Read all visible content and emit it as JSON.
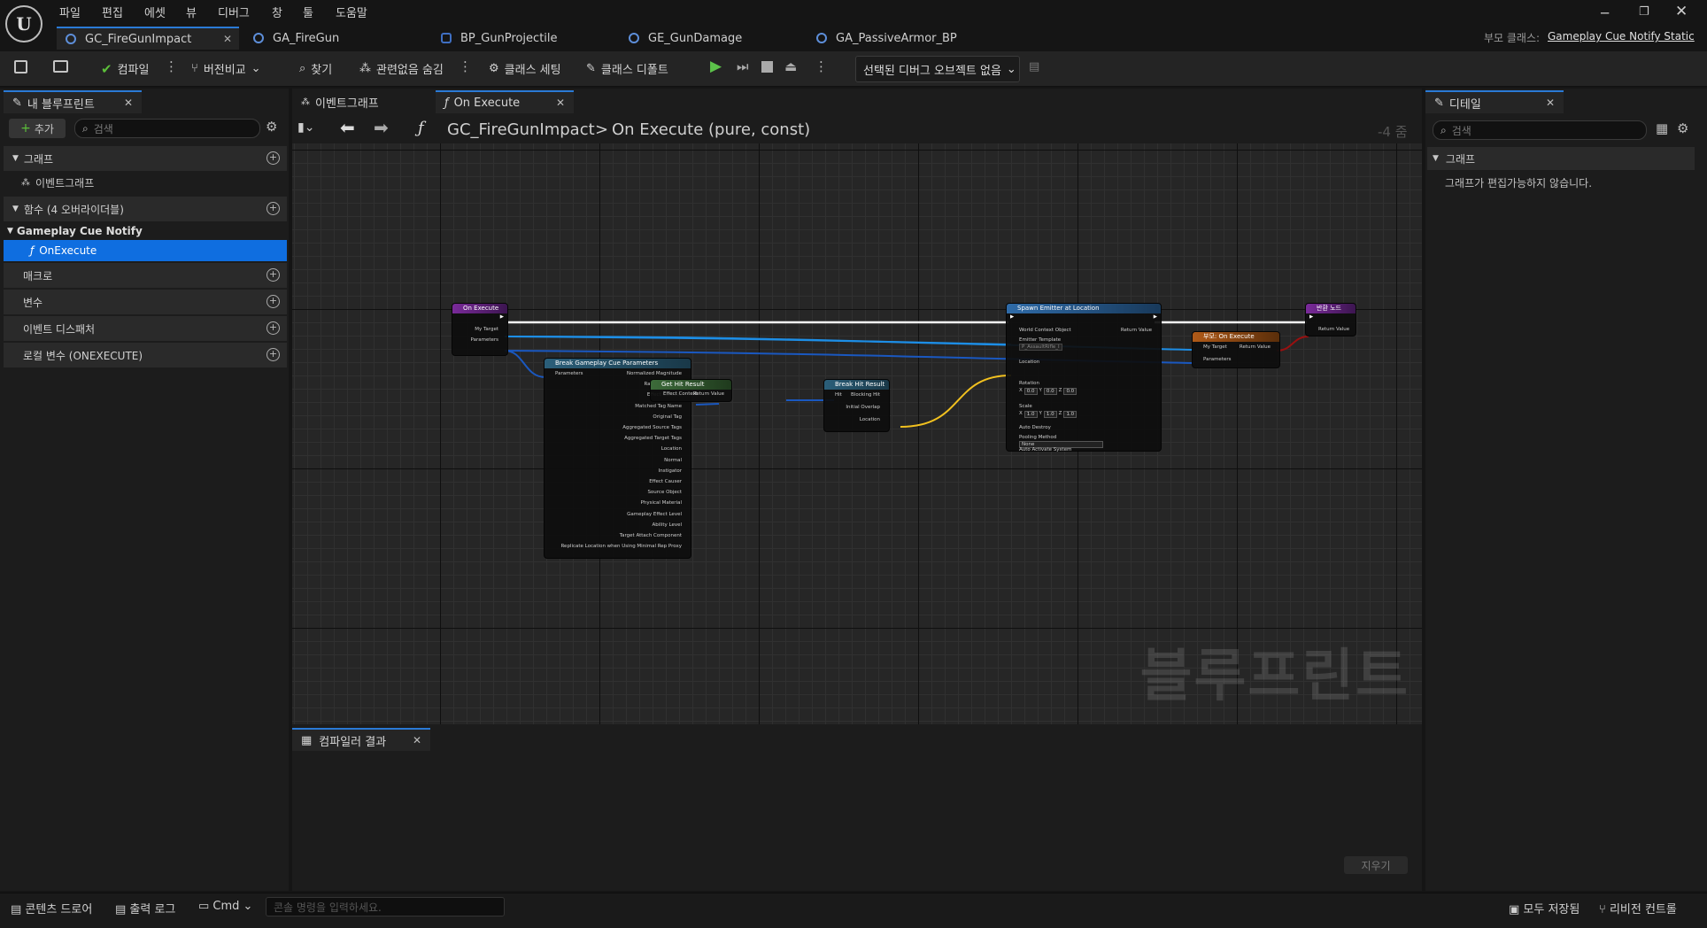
{
  "menu": [
    "파일",
    "편집",
    "에셋",
    "뷰",
    "디버그",
    "창",
    "툴",
    "도움말"
  ],
  "tabs": [
    {
      "label": "GC_FireGunImpact",
      "active": true
    },
    {
      "label": "GA_FireGun"
    },
    {
      "label": "BP_GunProjectile"
    },
    {
      "label": "GE_GunDamage"
    },
    {
      "label": "GA_PassiveArmor_BP"
    }
  ],
  "parent_class": {
    "label": "부모 클래스:",
    "value": "Gameplay Cue Notify Static"
  },
  "toolbar": {
    "compile": "컴파일",
    "diff": "버전비교",
    "find": "찾기",
    "hide_unrelated": "관련없음 숨김",
    "class_settings": "클래스 세팅",
    "class_defaults": "클래스 디폴트",
    "debug_object": "선택된 디버그 오브젝트 없음"
  },
  "my_blueprint": {
    "tab": "내 블루프린트",
    "add": "추가",
    "search_placeholder": "검색",
    "graphs": "그래프",
    "event_graph": "이벤트그래프",
    "functions": "함수 (4 오버라이더블)",
    "cue_notify": "Gameplay Cue Notify",
    "on_execute": "OnExecute",
    "macros": "매크로",
    "variables": "변수",
    "dispatchers": "이벤트 디스패처",
    "local_vars": "로컬 변수 (ONEXECUTE)"
  },
  "graph_tabs": {
    "event_graph": "이벤트그래프",
    "on_execute": "On Execute"
  },
  "breadcrumb": {
    "blueprint": "GC_FireGunImpact",
    "separator": ">",
    "function": "On Execute (pure, const)",
    "zoom": "-4 줌"
  },
  "details": {
    "tab": "디테일",
    "search_placeholder": "검색",
    "section": "그래프",
    "message": "그래프가 편집가능하지 않습니다."
  },
  "compiler": {
    "tab": "컴파일러 결과",
    "clear": "지우기"
  },
  "watermark": "블루프린트",
  "nodes": {
    "on_execute": {
      "title": "On Execute",
      "pins": [
        "My Target",
        "Parameters"
      ]
    },
    "break_params": {
      "title": "Break Gameplay Cue Parameters",
      "input": "Parameters",
      "pins": [
        "Normalized Magnitude",
        "Raw Magnitude",
        "Effect Context",
        "Matched Tag Name",
        "Original Tag",
        "Aggregated Source Tags",
        "Aggregated Target Tags",
        "Location",
        "Normal",
        "Instigator",
        "Effect Causer",
        "Source Object",
        "Physical Material",
        "Gameplay Effect Level",
        "Ability Level",
        "Target Attach Component",
        "Replicate Location when Using Minimal Rep Proxy"
      ]
    },
    "get_hit_result": {
      "title": "Get Hit Result",
      "input": "Effect Context",
      "output": "Return Value"
    },
    "break_hit": {
      "title": "Break Hit Result",
      "input": "Hit",
      "pins": [
        "Blocking Hit",
        "Initial Overlap",
        "Location"
      ]
    },
    "spawn_emitter": {
      "title": "Spawn Emitter at Location",
      "pins": [
        "World Context Object",
        "Emitter Template",
        "Location",
        "Rotation",
        "Scale",
        "Auto Destroy",
        "Pooling Method",
        "Auto Activate System"
      ],
      "output": "Return Value",
      "template_value": "P_AssaultRifle_I",
      "rotation": [
        "0.0",
        "0.0",
        "0.0"
      ],
      "scale": [
        "1.0",
        "1.0",
        "1.0"
      ],
      "pooling": "None",
      "axis_labels": [
        "X",
        "Y",
        "Z"
      ]
    },
    "parent_on_execute": {
      "title": "부모: On Execute",
      "pins": [
        "My Target",
        "Parameters"
      ],
      "output": "Return Value"
    },
    "return_node": {
      "title": "반환 노드",
      "pins": [
        "Return Value"
      ]
    }
  },
  "status": {
    "content_drawer": "콘텐츠 드로어",
    "output_log": "출력 로그",
    "cmd": "Cmd",
    "console_placeholder": "콘솔 명령을 입력하세요.",
    "save_all": "모두 저장됨",
    "revision": "리비전 컨트롤"
  },
  "colors": {
    "accent": "#2a7ad6",
    "selected": "#0f6ee0",
    "exec": "#ffffff",
    "object_pin": "#1d8ee6",
    "struct_pin": "#1a58c0",
    "vector_pin": "#f2c11f",
    "bool_pin": "#9a1010"
  }
}
